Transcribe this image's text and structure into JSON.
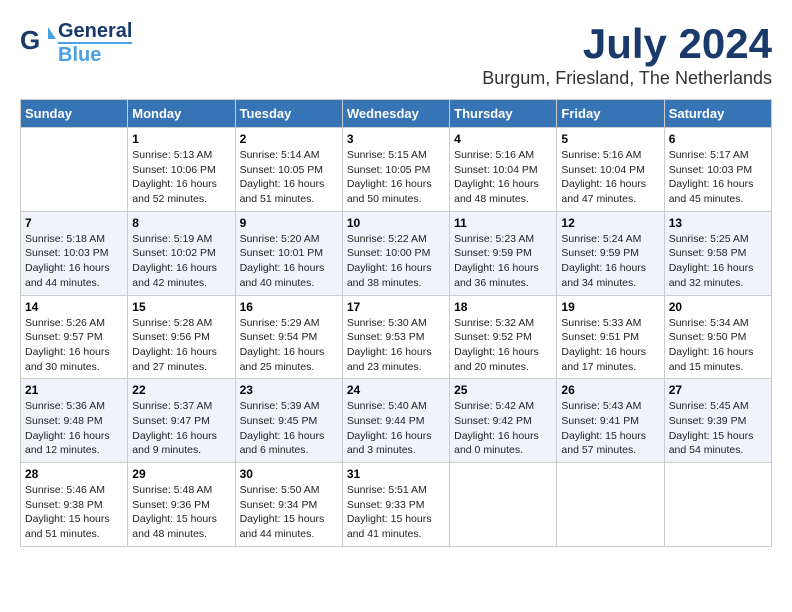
{
  "header": {
    "logo": {
      "line1": "General",
      "line2": "Blue"
    },
    "title": "July 2024",
    "location": "Burgum, Friesland, The Netherlands"
  },
  "calendar": {
    "days_of_week": [
      "Sunday",
      "Monday",
      "Tuesday",
      "Wednesday",
      "Thursday",
      "Friday",
      "Saturday"
    ],
    "weeks": [
      [
        {
          "day": "",
          "info": ""
        },
        {
          "day": "1",
          "info": "Sunrise: 5:13 AM\nSunset: 10:06 PM\nDaylight: 16 hours\nand 52 minutes."
        },
        {
          "day": "2",
          "info": "Sunrise: 5:14 AM\nSunset: 10:05 PM\nDaylight: 16 hours\nand 51 minutes."
        },
        {
          "day": "3",
          "info": "Sunrise: 5:15 AM\nSunset: 10:05 PM\nDaylight: 16 hours\nand 50 minutes."
        },
        {
          "day": "4",
          "info": "Sunrise: 5:16 AM\nSunset: 10:04 PM\nDaylight: 16 hours\nand 48 minutes."
        },
        {
          "day": "5",
          "info": "Sunrise: 5:16 AM\nSunset: 10:04 PM\nDaylight: 16 hours\nand 47 minutes."
        },
        {
          "day": "6",
          "info": "Sunrise: 5:17 AM\nSunset: 10:03 PM\nDaylight: 16 hours\nand 45 minutes."
        }
      ],
      [
        {
          "day": "7",
          "info": "Sunrise: 5:18 AM\nSunset: 10:03 PM\nDaylight: 16 hours\nand 44 minutes."
        },
        {
          "day": "8",
          "info": "Sunrise: 5:19 AM\nSunset: 10:02 PM\nDaylight: 16 hours\nand 42 minutes."
        },
        {
          "day": "9",
          "info": "Sunrise: 5:20 AM\nSunset: 10:01 PM\nDaylight: 16 hours\nand 40 minutes."
        },
        {
          "day": "10",
          "info": "Sunrise: 5:22 AM\nSunset: 10:00 PM\nDaylight: 16 hours\nand 38 minutes."
        },
        {
          "day": "11",
          "info": "Sunrise: 5:23 AM\nSunset: 9:59 PM\nDaylight: 16 hours\nand 36 minutes."
        },
        {
          "day": "12",
          "info": "Sunrise: 5:24 AM\nSunset: 9:59 PM\nDaylight: 16 hours\nand 34 minutes."
        },
        {
          "day": "13",
          "info": "Sunrise: 5:25 AM\nSunset: 9:58 PM\nDaylight: 16 hours\nand 32 minutes."
        }
      ],
      [
        {
          "day": "14",
          "info": "Sunrise: 5:26 AM\nSunset: 9:57 PM\nDaylight: 16 hours\nand 30 minutes."
        },
        {
          "day": "15",
          "info": "Sunrise: 5:28 AM\nSunset: 9:56 PM\nDaylight: 16 hours\nand 27 minutes."
        },
        {
          "day": "16",
          "info": "Sunrise: 5:29 AM\nSunset: 9:54 PM\nDaylight: 16 hours\nand 25 minutes."
        },
        {
          "day": "17",
          "info": "Sunrise: 5:30 AM\nSunset: 9:53 PM\nDaylight: 16 hours\nand 23 minutes."
        },
        {
          "day": "18",
          "info": "Sunrise: 5:32 AM\nSunset: 9:52 PM\nDaylight: 16 hours\nand 20 minutes."
        },
        {
          "day": "19",
          "info": "Sunrise: 5:33 AM\nSunset: 9:51 PM\nDaylight: 16 hours\nand 17 minutes."
        },
        {
          "day": "20",
          "info": "Sunrise: 5:34 AM\nSunset: 9:50 PM\nDaylight: 16 hours\nand 15 minutes."
        }
      ],
      [
        {
          "day": "21",
          "info": "Sunrise: 5:36 AM\nSunset: 9:48 PM\nDaylight: 16 hours\nand 12 minutes."
        },
        {
          "day": "22",
          "info": "Sunrise: 5:37 AM\nSunset: 9:47 PM\nDaylight: 16 hours\nand 9 minutes."
        },
        {
          "day": "23",
          "info": "Sunrise: 5:39 AM\nSunset: 9:45 PM\nDaylight: 16 hours\nand 6 minutes."
        },
        {
          "day": "24",
          "info": "Sunrise: 5:40 AM\nSunset: 9:44 PM\nDaylight: 16 hours\nand 3 minutes."
        },
        {
          "day": "25",
          "info": "Sunrise: 5:42 AM\nSunset: 9:42 PM\nDaylight: 16 hours\nand 0 minutes."
        },
        {
          "day": "26",
          "info": "Sunrise: 5:43 AM\nSunset: 9:41 PM\nDaylight: 15 hours\nand 57 minutes."
        },
        {
          "day": "27",
          "info": "Sunrise: 5:45 AM\nSunset: 9:39 PM\nDaylight: 15 hours\nand 54 minutes."
        }
      ],
      [
        {
          "day": "28",
          "info": "Sunrise: 5:46 AM\nSunset: 9:38 PM\nDaylight: 15 hours\nand 51 minutes."
        },
        {
          "day": "29",
          "info": "Sunrise: 5:48 AM\nSunset: 9:36 PM\nDaylight: 15 hours\nand 48 minutes."
        },
        {
          "day": "30",
          "info": "Sunrise: 5:50 AM\nSunset: 9:34 PM\nDaylight: 15 hours\nand 44 minutes."
        },
        {
          "day": "31",
          "info": "Sunrise: 5:51 AM\nSunset: 9:33 PM\nDaylight: 15 hours\nand 41 minutes."
        },
        {
          "day": "",
          "info": ""
        },
        {
          "day": "",
          "info": ""
        },
        {
          "day": "",
          "info": ""
        }
      ]
    ]
  }
}
